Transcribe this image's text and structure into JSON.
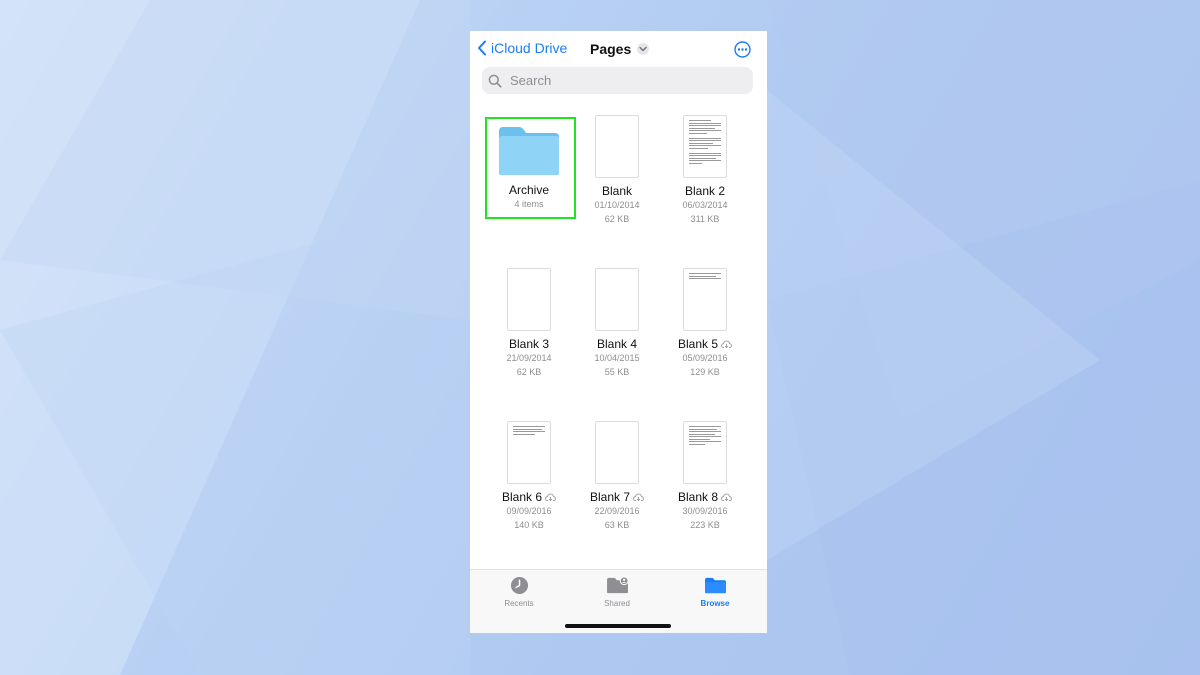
{
  "nav": {
    "back_label": "iCloud Drive",
    "title": "Pages"
  },
  "search": {
    "placeholder": "Search"
  },
  "files": [
    {
      "name": "Archive",
      "line1": "4 items",
      "line2": "",
      "kind": "folder",
      "cloud": false,
      "selected": true
    },
    {
      "name": "Blank",
      "line1": "01/10/2014",
      "line2": "62 KB",
      "kind": "blank",
      "cloud": false
    },
    {
      "name": "Blank 2",
      "line1": "06/03/2014",
      "line2": "311 KB",
      "kind": "text-full",
      "cloud": false
    },
    {
      "name": "Blank 3",
      "line1": "21/09/2014",
      "line2": "62 KB",
      "kind": "blank",
      "cloud": false
    },
    {
      "name": "Blank 4",
      "line1": "10/04/2015",
      "line2": "55 KB",
      "kind": "blank",
      "cloud": false
    },
    {
      "name": "Blank 5",
      "line1": "05/09/2016",
      "line2": "129 KB",
      "kind": "text-short",
      "cloud": true
    },
    {
      "name": "Blank 6",
      "line1": "09/09/2016",
      "line2": "140 KB",
      "kind": "text-short",
      "cloud": true
    },
    {
      "name": "Blank 7",
      "line1": "22/09/2016",
      "line2": "63 KB",
      "kind": "blank",
      "cloud": true
    },
    {
      "name": "Blank 8",
      "line1": "30/09/2016",
      "line2": "223 KB",
      "kind": "text-med",
      "cloud": true
    }
  ],
  "tabs": [
    {
      "label": "Recents",
      "icon": "clock-icon",
      "active": false
    },
    {
      "label": "Shared",
      "icon": "shared-folder-icon",
      "active": false
    },
    {
      "label": "Browse",
      "icon": "folder-icon",
      "active": true
    }
  ],
  "colors": {
    "accent": "#1a7cf5",
    "highlight": "#22e322",
    "folder": "#7fcdf5"
  }
}
